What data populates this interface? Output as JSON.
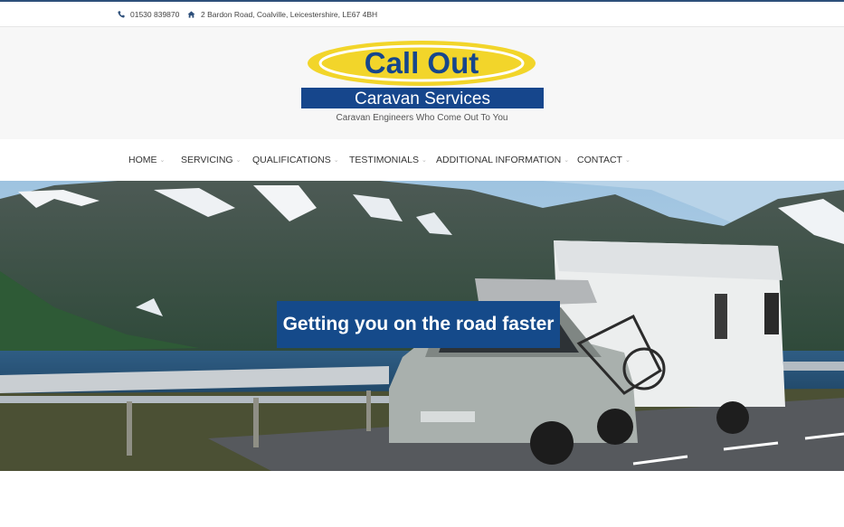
{
  "topbar": {
    "phone": "01530 839870",
    "address": "2 Bardon Road, Coalville, Leicestershire, LE67 4BH",
    "phone_icon": "phone-icon",
    "address_icon": "home-icon"
  },
  "header": {
    "logo_line1": "Call Out",
    "logo_line2": "Caravan Services",
    "tagline": "Caravan Engineers Who Come Out To You",
    "brand_yellow": "#f2d52a",
    "brand_blue": "#16468c"
  },
  "nav": {
    "items": [
      {
        "label": "HOME"
      },
      {
        "label": "SERVICING"
      },
      {
        "label": "QUALIFICATIONS"
      },
      {
        "label": "TESTIMONIALS"
      },
      {
        "label": "ADDITIONAL INFORMATION"
      },
      {
        "label": "CONTACT"
      }
    ],
    "chevron": "⌄"
  },
  "hero": {
    "title": "Getting you on the road faster",
    "accent": "#154a8a"
  }
}
